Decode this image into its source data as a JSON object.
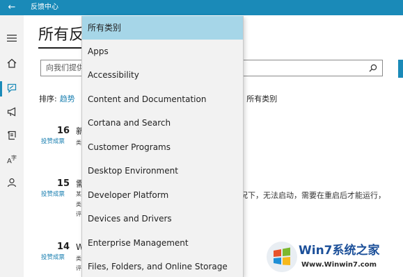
{
  "app": {
    "title": "反馈中心"
  },
  "page": {
    "title": "所有反",
    "search_placeholder": "向我们提供"
  },
  "sort": {
    "label": "排序:",
    "value": "趋势"
  },
  "filter": {
    "text": ": 所有类别"
  },
  "dropdown": {
    "selected": "所有类别",
    "items": [
      "所有类别",
      "Apps",
      "Accessibility",
      "Content and Documentation",
      "Cortana and Search",
      "Customer Programs",
      "Desktop Environment",
      "Developer Platform",
      "Devices and Drivers",
      "Enterprise Management",
      "Files, Folders, and Online Storage"
    ]
  },
  "feedback_items": [
    {
      "votes": "16",
      "vote_label": "投赞成票",
      "title_char": "新",
      "sub": [
        "类"
      ]
    },
    {
      "votes": "15",
      "vote_label": "投赞成票",
      "title_char": "需",
      "sub": [
        "某",
        "类",
        "评"
      ]
    },
    {
      "votes": "14",
      "vote_label": "投赞成票",
      "title_char": "W",
      "sub": [
        "类",
        "评"
      ]
    }
  ],
  "feedback_desc": "况下，无法启动，需要在重启后才能运行，",
  "watermark": {
    "title": "Win7系统之家",
    "url": "Www.Winwin7.com"
  },
  "colors": {
    "accent": "#1a8ab8",
    "selected": "#a6d6e8",
    "menu_bg": "#f2f2f2",
    "link": "#1a7fb0"
  },
  "icons": {
    "back": "back-arrow-icon",
    "search": "search-icon"
  }
}
